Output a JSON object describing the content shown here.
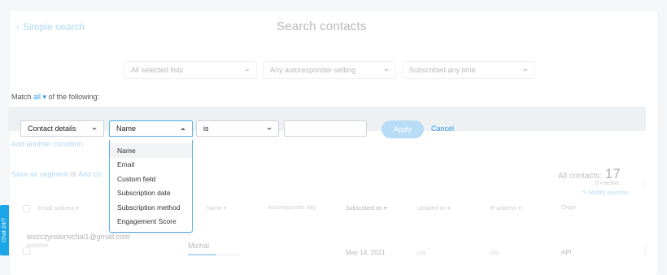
{
  "header": {
    "back_label": "Simple search",
    "title": "Search contacts"
  },
  "filters": [
    {
      "label": "All selected lists"
    },
    {
      "label": "Any autoresponder setting"
    },
    {
      "label": "Subscribed any time"
    }
  ],
  "match": {
    "prefix": "Match",
    "mode": "all",
    "suffix": "of the following:"
  },
  "condition": {
    "field_group": "Contact details",
    "field": "Name",
    "operator": "is",
    "value": "",
    "apply_label": "Apply",
    "cancel_label": "Cancel"
  },
  "dropdown": {
    "options": [
      "Name",
      "Email",
      "Custom field",
      "Subscription date",
      "Subscription method",
      "Engagement Score"
    ],
    "highlighted": "Name"
  },
  "add_condition_label": "Add another condition",
  "segment": {
    "save_label": "Save as segment",
    "or_label": "or",
    "add_label": "Add co"
  },
  "summary": {
    "all_label": "All contacts:",
    "count": "17",
    "inactive": "6 inactive",
    "modify_label": "Modify columns"
  },
  "table": {
    "columns": [
      "Email address",
      "Name",
      "Autoresponder day",
      "Subscribed on",
      "Updated on",
      "IP address",
      "Origin"
    ],
    "rows": [
      {
        "email": "leszczynskimichal1@gmail.com",
        "list": "dostebie",
        "name": "Michal",
        "engagement": 0.55,
        "autoresponder": "",
        "subscribed": "May 14, 2021",
        "updated": "n/a",
        "ip": "n/a",
        "origin": "API"
      }
    ]
  },
  "chat_label": "Chat 24/7",
  "colors": {
    "accent": "#2e9ae6",
    "chat": "#1aa6e8"
  }
}
